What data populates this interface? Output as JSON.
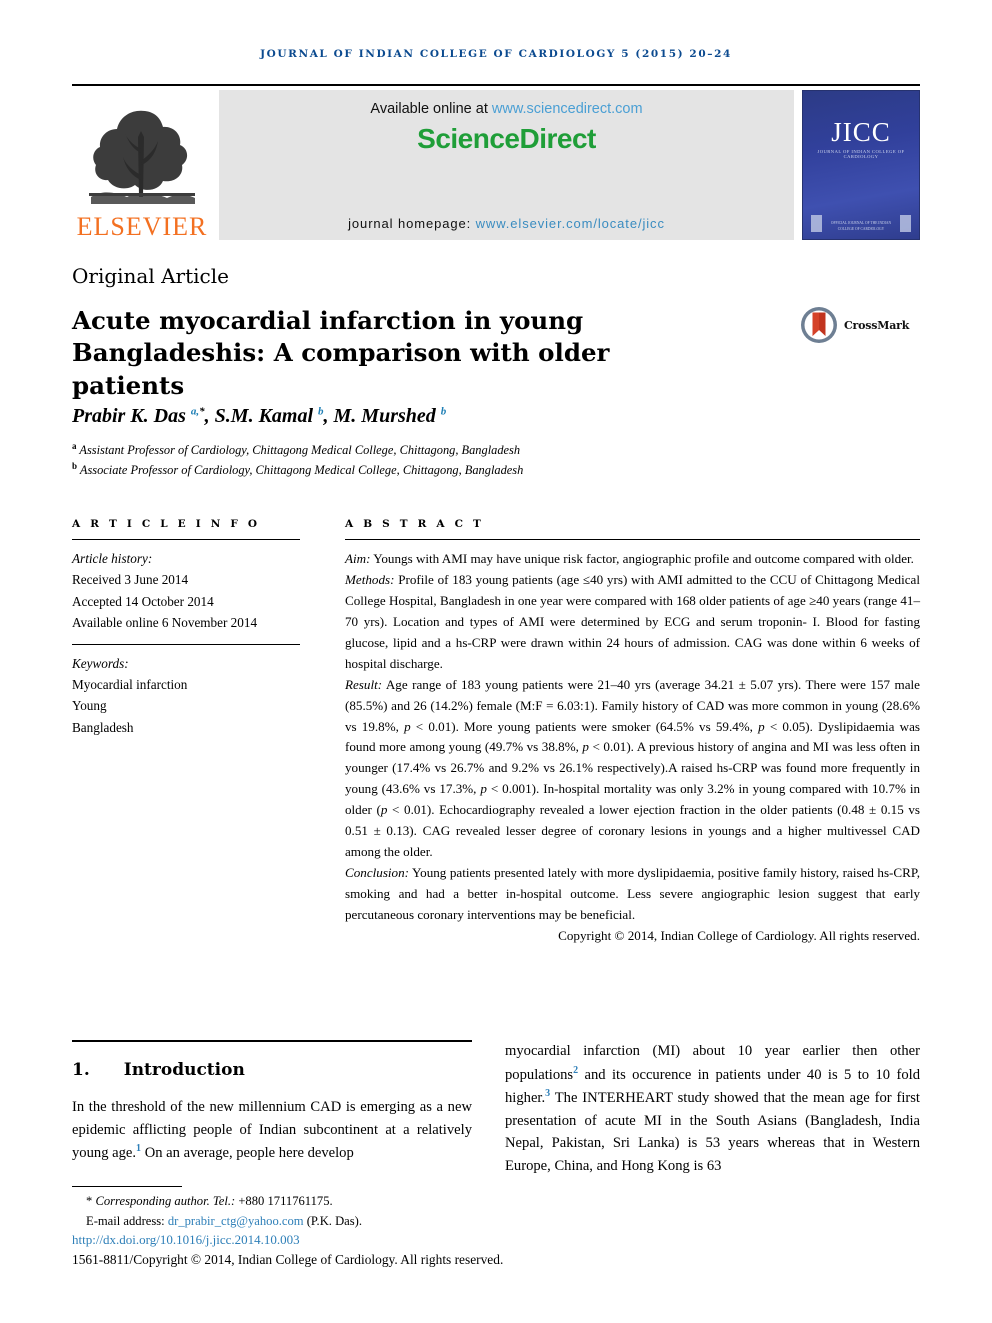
{
  "running_head": "JOURNAL OF INDIAN COLLEGE OF CARDIOLOGY 5 (2015) 20–24",
  "masthead": {
    "publisher_name": "ELSEVIER",
    "available_prefix": "Available online at ",
    "available_url": "www.sciencedirect.com",
    "sciencedirect_logo": "ScienceDirect",
    "homepage_prefix": "journal homepage: ",
    "homepage_url": "www.elsevier.com/locate/jicc",
    "cover": {
      "title": "JICC",
      "subtitle": "JOURNAL OF INDIAN COLLEGE OF CARDIOLOGY",
      "footer_note": "OFFICIAL JOURNAL OF THE INDIAN COLLEGE OF CARDIOLOGY"
    },
    "colors": {
      "band_background": "#E4E4E4",
      "sciencedirect_green": "#1F9E38",
      "elsevier_orange": "#F37021",
      "link_blue": "#3A8CC0",
      "cover_blue": "#31409B"
    }
  },
  "article": {
    "type": "Original Article",
    "title_line1": "Acute myocardial infarction in young",
    "title_line2": "Bangladeshis: A comparison with older patients",
    "crossmark_label": "CrossMark",
    "authors_html": "Prabir K. Das <sup>a,</sup><sup class=\"star\">*</sup>, S.M. Kamal <sup>b</sup>, M. Murshed <sup>b</sup>",
    "affiliations": [
      {
        "marker": "a",
        "text": "Assistant Professor of Cardiology, Chittagong Medical College, Chittagong, Bangladesh"
      },
      {
        "marker": "b",
        "text": "Associate Professor of Cardiology, Chittagong Medical College, Chittagong, Bangladesh"
      }
    ]
  },
  "info": {
    "heading": "A R T I C L E   I N F O",
    "history_label": "Article history:",
    "history": [
      "Received 3 June 2014",
      "Accepted 14 October 2014",
      "Available online 6 November 2014"
    ],
    "keywords_label": "Keywords:",
    "keywords": [
      "Myocardial infarction",
      "Young",
      "Bangladesh"
    ]
  },
  "abstract": {
    "heading": "A B S T R A C T",
    "aim_label": "Aim:",
    "aim_text": " Youngs with AMI may have unique risk factor, angiographic profile and outcome compared with older.",
    "methods_label": "Methods:",
    "methods_text": " Profile of 183 young patients (age ≤40 yrs) with AMI admitted to the CCU of Chittagong Medical College Hospital, Bangladesh in one year were compared with 168 older patients of age ≥40 years (range 41–70 yrs). Location and types of AMI were determined by ECG and serum troponin- I. Blood for fasting glucose, lipid and a hs-CRP were drawn within 24 hours of admission. CAG was done within 6 weeks of hospital discharge.",
    "result_label": "Result:",
    "result_text_1": " Age range of 183 young patients were 21–40 yrs (average 34.21 ± 5.07 yrs). There were 157 male (85.5%) and 26 (14.2%) female (M:F = 6.03:1). Family history of CAD was more common in young (28.6% vs 19.8%, ",
    "result_p1": "p",
    "result_text_2": " < 0.01). More young patients were smoker (64.5% vs 59.4%, ",
    "result_p2": "p",
    "result_text_3": " < 0.05). Dyslipidaemia was found more among young (49.7% vs 38.8%, ",
    "result_p3": "p",
    "result_text_4": " < 0.01). A previous history of angina and MI was less often in younger (17.4% vs 26.7% and 9.2% vs 26.1% respectively).A raised hs-CRP was found more frequently in young (43.6% vs 17.3%, ",
    "result_p4": "p",
    "result_text_5": " < 0.001). In-hospital mortality was only 3.2% in young compared with 10.7% in older (",
    "result_p5": "p",
    "result_text_6": " < 0.01). Echocardiography revealed a lower ejection fraction in the older patients (0.48 ± 0.15 vs 0.51 ± 0.13). CAG revealed lesser degree of coronary lesions in youngs and a higher multivessel CAD among the older.",
    "conclusion_label": "Conclusion:",
    "conclusion_text": " Young patients presented lately with more dyslipidaemia, positive family history, raised hs-CRP, smoking and had a better in-hospital outcome. Less severe angiographic lesion suggest that early percutaneous coronary interventions may be beneficial.",
    "copyright": "Copyright © 2014, Indian College of Cardiology. All rights reserved."
  },
  "body": {
    "section_number": "1.",
    "section_title": "Introduction",
    "left_text_1": "In the threshold of the new millennium CAD is emerging as a new epidemic afflicting people of Indian subcontinent at a relatively young age.",
    "left_ref_1": "1",
    "left_text_2": " On an average, people here develop",
    "right_text_1": "myocardial infarction (MI) about 10 year earlier then other populations",
    "right_ref_1": "2",
    "right_text_2": " and its occurence in patients under 40 is 5 to 10 fold higher.",
    "right_ref_2": "3",
    "right_text_3": " The INTERHEART study showed that the mean age for first presentation of acute MI in the South Asians (Bangladesh, India Nepal, Pakistan, Sri Lanka) is 53 years whereas that in Western Europe, China, and Hong Kong is 63"
  },
  "footer": {
    "corresponding_marker": "*",
    "corresponding_text": "Corresponding author. Tel.: ",
    "corresponding_tel": "+880 1711761175.",
    "email_label": "E-mail address: ",
    "email_address": "dr_prabir_ctg@yahoo.com",
    "email_owner": " (P.K. Das).",
    "doi": "http://dx.doi.org/10.1016/j.jicc.2014.10.003",
    "issn_line": "1561-8811/Copyright © 2014, Indian College of Cardiology. All rights reserved."
  }
}
